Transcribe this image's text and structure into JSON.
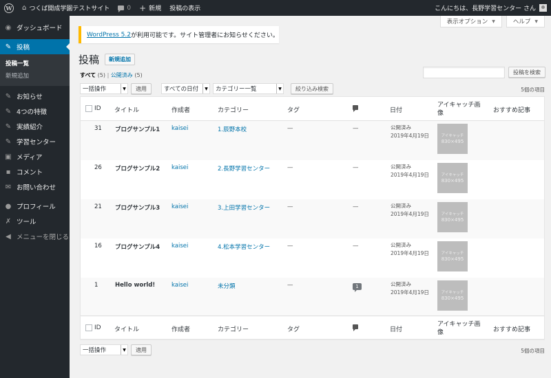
{
  "adminbar": {
    "site_name": "つくば開成学園テストサイト",
    "comments_count": "0",
    "new_label": "新規",
    "view_posts": "投稿の表示",
    "greeting": "こんにちは、長野学習センター さん"
  },
  "sidebar": {
    "dashboard": "ダッシュボード",
    "posts": "投稿",
    "posts_sub": [
      "投稿一覧",
      "新規追加"
    ],
    "items": [
      {
        "label": "お知らせ",
        "icon": "pin-icon"
      },
      {
        "label": "4つの特徴",
        "icon": "pin-icon"
      },
      {
        "label": "実績紹介",
        "icon": "pin-icon"
      },
      {
        "label": "学習センター",
        "icon": "pin-icon"
      },
      {
        "label": "メディア",
        "icon": "media-icon"
      },
      {
        "label": "コメント",
        "icon": "comment-icon"
      },
      {
        "label": "お問い合わせ",
        "icon": "mail-icon"
      }
    ],
    "items2": [
      {
        "label": "プロフィール",
        "icon": "user-icon"
      },
      {
        "label": "ツール",
        "icon": "wrench-icon"
      },
      {
        "label": "メニューを閉じる",
        "icon": "collapse-icon"
      }
    ]
  },
  "screen_options": "表示オプション",
  "help": "ヘルプ",
  "notice": {
    "link": "WordPress 5.2",
    "text": " が利用可能です。サイト管理者にお知らせください。"
  },
  "page": {
    "title": "投稿",
    "add_new": "新規追加"
  },
  "filters": {
    "all_label": "すべて",
    "all_count": "(5)",
    "separator": "|",
    "published_label": "公開済み",
    "published_count": "(5)"
  },
  "search_button": "投稿を検索",
  "tablenav": {
    "bulk_action": "一括操作",
    "apply": "適用",
    "all_dates": "すべての日付",
    "category_list": "カテゴリー一覧",
    "filter": "絞り込み検索",
    "items_count": "5個の項目"
  },
  "columns": {
    "id": "ID",
    "title": "タイトル",
    "author": "作成者",
    "categories": "カテゴリー",
    "tags": "タグ",
    "date": "日付",
    "thumbnail": "アイキャッチ画像",
    "featured": "おすすめ記事"
  },
  "rows": [
    {
      "id": "31",
      "title": "ブログサンプル1",
      "author": "kaisei",
      "category": "1.辰野本校",
      "tags": "—",
      "comments": "—",
      "status": "公開済み",
      "date": "2019年4月19日",
      "thumb_title": "アイキャッチ",
      "thumb_size": "830×495"
    },
    {
      "id": "26",
      "title": "ブログサンプル2",
      "author": "kaisei",
      "category": "2.長野学習センター",
      "tags": "—",
      "comments": "—",
      "status": "公開済み",
      "date": "2019年4月19日",
      "thumb_title": "アイキャッチ",
      "thumb_size": "830×495"
    },
    {
      "id": "21",
      "title": "ブログサンプル3",
      "author": "kaisei",
      "category": "3.上田学習センター",
      "tags": "—",
      "comments": "—",
      "status": "公開済み",
      "date": "2019年4月19日",
      "thumb_title": "アイキャッチ",
      "thumb_size": "830×495"
    },
    {
      "id": "16",
      "title": "ブログサンプル4",
      "author": "kaisei",
      "category": "4.松本学習センター",
      "tags": "—",
      "comments": "—",
      "status": "公開済み",
      "date": "2019年4月19日",
      "thumb_title": "アイキャッチ",
      "thumb_size": "830×495"
    },
    {
      "id": "1",
      "title": "Hello world!",
      "author": "kaisei",
      "category": "未分類",
      "tags": "—",
      "comments": "1",
      "status": "公開済み",
      "date": "2019年4月19日",
      "thumb_title": "アイキャッチ",
      "thumb_size": "830×495"
    }
  ],
  "colors": {
    "adminbar": "#23282d",
    "accent": "#0073aa",
    "notice_border": "#ffb900"
  }
}
